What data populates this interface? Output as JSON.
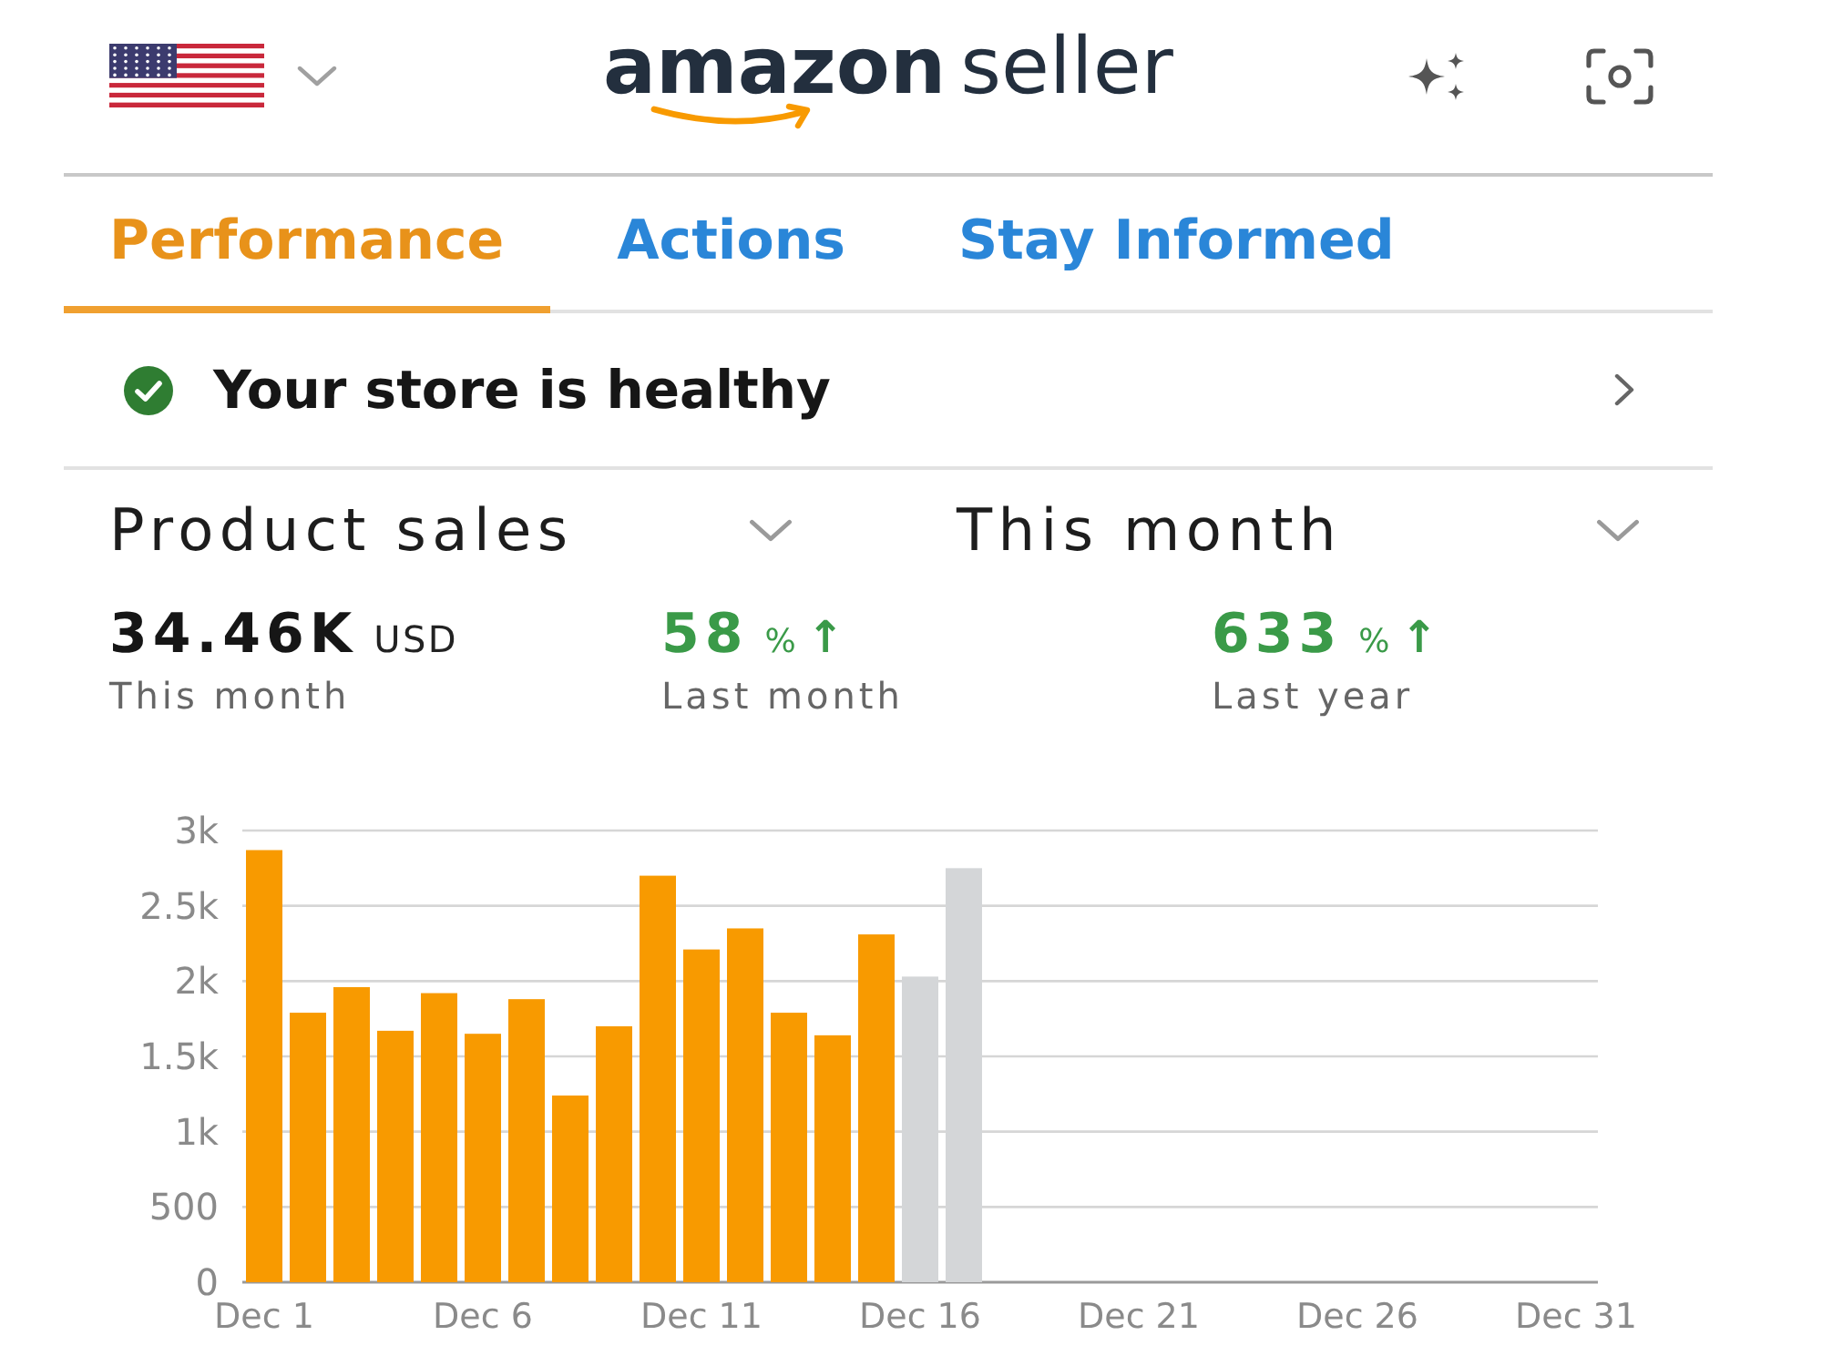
{
  "logo": {
    "brand": "amazon",
    "product": "seller"
  },
  "tabs": [
    {
      "label": "Performance",
      "selected": true
    },
    {
      "label": "Actions",
      "selected": false
    },
    {
      "label": "Stay Informed",
      "selected": false
    }
  ],
  "health": {
    "message": "Your store is healthy",
    "healthy": true
  },
  "selectors": [
    {
      "value": "Product sales"
    },
    {
      "value": "This month"
    }
  ],
  "metrics": [
    {
      "kind": "total",
      "value": "34.46K",
      "unit": "USD",
      "label": "This month"
    },
    {
      "kind": "change",
      "value": "58",
      "unit": "%",
      "arrow": "↑",
      "label": "Last month"
    },
    {
      "kind": "change",
      "value": "633",
      "unit": "%",
      "arrow": "↑",
      "label": "Last year"
    }
  ],
  "chart_data": {
    "type": "bar",
    "categories": [
      "Dec 1",
      null,
      null,
      null,
      null,
      "Dec 6",
      null,
      null,
      null,
      null,
      "Dec 11",
      null,
      null,
      null,
      null,
      "Dec 16",
      null,
      null,
      null,
      null,
      "Dec 21",
      null,
      null,
      null,
      null,
      "Dec 26",
      null,
      null,
      null,
      null,
      "Dec 31"
    ],
    "series": [
      {
        "color": "#f89a00",
        "values": [
          2870,
          1790,
          1960,
          1670,
          1920,
          1650,
          1880,
          1240,
          1700,
          2700,
          2210,
          2350,
          1790,
          1640,
          2310,
          null,
          null,
          null,
          null,
          null,
          null,
          null,
          null,
          null,
          null,
          null,
          null,
          null,
          null,
          null,
          null
        ]
      },
      {
        "color": "#d4d6d8",
        "values": [
          null,
          null,
          null,
          null,
          null,
          null,
          null,
          null,
          null,
          null,
          null,
          null,
          null,
          null,
          null,
          2030,
          2750,
          null,
          null,
          null,
          null,
          null,
          null,
          null,
          null,
          null,
          null,
          null,
          null,
          null,
          null
        ]
      }
    ],
    "ylim": [
      0,
      3000
    ],
    "yticks": [
      {
        "value": 0,
        "label": "0"
      },
      {
        "value": 500,
        "label": "500"
      },
      {
        "value": 1000,
        "label": "1k"
      },
      {
        "value": 1500,
        "label": "1.5k"
      },
      {
        "value": 2000,
        "label": "2k"
      },
      {
        "value": 2500,
        "label": "2.5k"
      },
      {
        "value": 3000,
        "label": "3k"
      }
    ],
    "grid": true
  }
}
